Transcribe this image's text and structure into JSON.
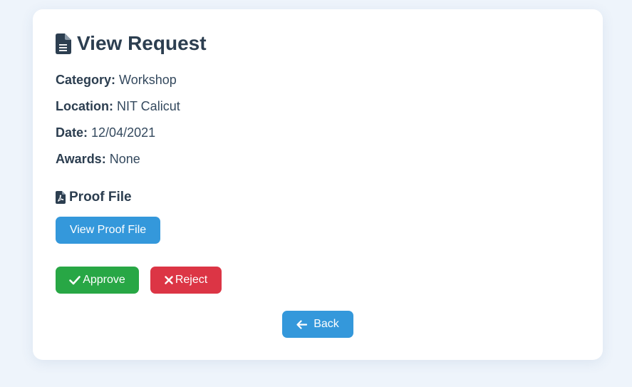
{
  "page": {
    "title": "View Request",
    "title_icon": "file-text-icon"
  },
  "details": [
    {
      "label": "Category:",
      "value": "Workshop"
    },
    {
      "label": "Location:",
      "value": "NIT Calicut"
    },
    {
      "label": "Date:",
      "value": "12/04/2021"
    },
    {
      "label": "Awards:",
      "value": "None"
    }
  ],
  "proof": {
    "heading": "Proof File",
    "heading_icon": "file-pdf-icon",
    "view_label": "View Proof File"
  },
  "actions": {
    "approve_label": "Approve",
    "approve_icon": "check-icon",
    "reject_label": "Reject",
    "reject_icon": "x-icon",
    "back_label": "Back",
    "back_icon": "arrow-left-icon"
  },
  "colors": {
    "background": "#eef4fb",
    "card": "#ffffff",
    "text": "#2c3e50",
    "primary": "#3498db",
    "success": "#28a745",
    "danger": "#dc3545"
  }
}
